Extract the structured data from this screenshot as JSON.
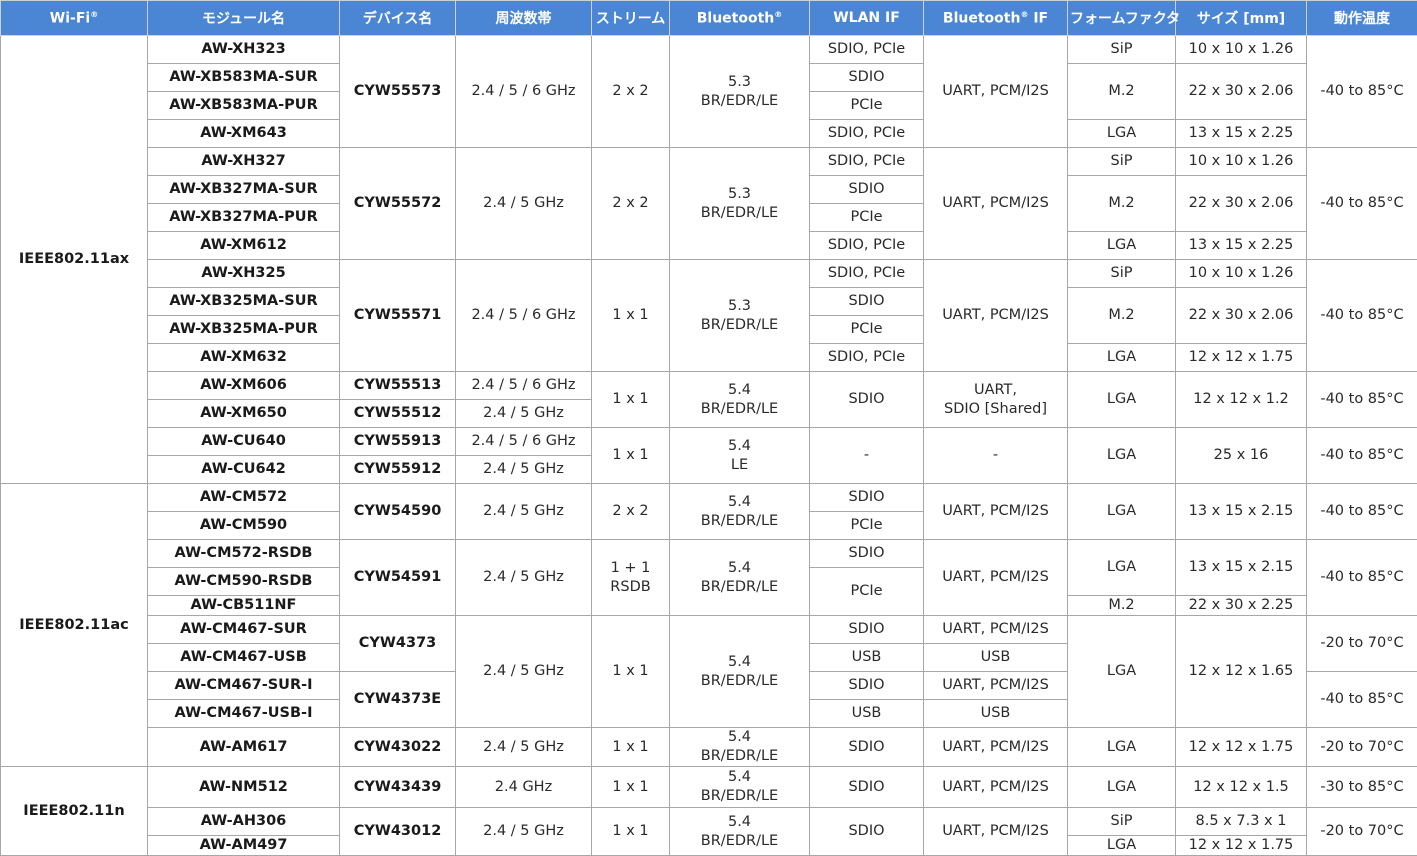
{
  "headers": [
    "Wi-Fi",
    "モジュール名",
    "デバイス名",
    "周波数帯",
    "ストリーム",
    "Bluetooth",
    "WLAN IF",
    "Bluetooth",
    "フォームファクタ",
    "サイズ [mm]",
    "動作温度"
  ],
  "header_registered_mark": "®",
  "header_suffix_if": "IF",
  "rows": [
    [
      "IEEE802.11ax",
      "AW-XH323",
      "CYW55573",
      "2.4 / 5 / 6 GHz",
      "2 x 2",
      "5.3",
      "BR/EDR/LE",
      "SDIO, PCIe",
      "UART, PCM/I2S",
      "SiP",
      "10 x 10 x 1.26",
      "-40 to 85°C"
    ],
    [
      "",
      "AW-XB583MA-SUR",
      "",
      "",
      "",
      "",
      "",
      "SDIO",
      "",
      "M.2",
      "22 x 30 x 2.06",
      ""
    ],
    [
      "",
      "AW-XB583MA-PUR",
      "",
      "",
      "",
      "",
      "",
      "PCIe",
      "",
      "",
      "",
      ""
    ],
    [
      "",
      "AW-XM643",
      "",
      "",
      "",
      "",
      "",
      "SDIO, PCIe",
      "",
      "LGA",
      "13 x 15 x 2.25",
      ""
    ],
    [
      "",
      "AW-XH327",
      "CYW55572",
      "2.4 / 5 GHz",
      "2 x 2",
      "5.3",
      "BR/EDR/LE",
      "SDIO, PCIe",
      "UART, PCM/I2S",
      "SiP",
      "10 x 10 x 1.26",
      "-40 to 85°C"
    ],
    [
      "",
      "AW-XB327MA-SUR",
      "",
      "",
      "",
      "",
      "",
      "SDIO",
      "",
      "M.2",
      "22 x 30 x 2.06",
      ""
    ],
    [
      "",
      "AW-XB327MA-PUR",
      "",
      "",
      "",
      "",
      "",
      "PCIe",
      "",
      "",
      "",
      ""
    ],
    [
      "",
      "AW-XM612",
      "",
      "",
      "",
      "",
      "",
      "SDIO, PCIe",
      "",
      "LGA",
      "13 x 15 x 2.25",
      ""
    ],
    [
      "",
      "AW-XH325",
      "CYW55571",
      "2.4 / 5 / 6 GHz",
      "1 x 1",
      "5.3",
      "BR/EDR/LE",
      "SDIO, PCIe",
      "UART, PCM/I2S",
      "SiP",
      "10 x 10 x 1.26",
      "-40 to 85°C"
    ],
    [
      "",
      "AW-XB325MA-SUR",
      "",
      "",
      "",
      "",
      "",
      "SDIO",
      "",
      "M.2",
      "22 x 30 x 2.06",
      ""
    ],
    [
      "",
      "AW-XB325MA-PUR",
      "",
      "",
      "",
      "",
      "",
      "PCIe",
      "",
      "",
      "",
      ""
    ],
    [
      "",
      "AW-XM632",
      "",
      "",
      "",
      "",
      "",
      "SDIO, PCIe",
      "",
      "LGA",
      "12 x 12 x 1.75",
      ""
    ],
    [
      "",
      "AW-XM606",
      "CYW55513",
      "2.4 / 5 / 6 GHz",
      "1 x 1",
      "5.4",
      "BR/EDR/LE",
      "SDIO",
      "UART,",
      "LGA",
      "12 x 12 x 1.2",
      "-40 to 85°C"
    ],
    [
      "",
      "AW-XM650",
      "CYW55512",
      "2.4 / 5 GHz",
      "",
      "",
      "",
      "",
      "SDIO [Shared]",
      "",
      "",
      ""
    ],
    [
      "",
      "AW-CU640",
      "CYW55913",
      "2.4 / 5 / 6 GHz",
      "1 x 1",
      "5.4",
      "LE",
      "-",
      "-",
      "LGA",
      "25 x 16",
      "-40 to 85°C"
    ],
    [
      "",
      "AW-CU642",
      "CYW55912",
      "2.4 / 5 GHz",
      "",
      "",
      "",
      "",
      "",
      "",
      "",
      ""
    ],
    [
      "IEEE802.11ac",
      "AW-CM572",
      "CYW54590",
      "2.4 / 5 GHz",
      "2 x 2",
      "5.4",
      "BR/EDR/LE",
      "SDIO",
      "UART, PCM/I2S",
      "LGA",
      "13 x 15 x 2.15",
      "-40 to 85°C"
    ],
    [
      "",
      "AW-CM590",
      "",
      "",
      "",
      "",
      "",
      "PCIe",
      "",
      "",
      "",
      ""
    ],
    [
      "",
      "AW-CM572-RSDB",
      "CYW54591",
      "2.4 / 5 GHz",
      "1 + 1",
      "5.4",
      "BR/EDR/LE",
      "SDIO",
      "UART, PCM/I2S",
      "LGA",
      "13 x 15 x 2.15",
      "-40 to 85°C"
    ],
    [
      "",
      "AW-CM590-RSDB",
      "",
      "",
      "RSDB",
      "",
      "",
      "PCIe",
      "",
      "",
      "",
      ""
    ],
    [
      "",
      "AW-CB511NF",
      "",
      "",
      "",
      "",
      "",
      "",
      "",
      "M.2",
      "22 x 30 x 2.25",
      ""
    ],
    [
      "",
      "AW-CM467-SUR",
      "CYW4373",
      "2.4 / 5 GHz",
      "1 x 1",
      "5.4",
      "BR/EDR/LE",
      "SDIO",
      "UART, PCM/I2S",
      "LGA",
      "12 x 12 x 1.65",
      "-20 to 70°C"
    ],
    [
      "",
      "AW-CM467-USB",
      "",
      "",
      "",
      "",
      "",
      "USB",
      "USB",
      "",
      "",
      ""
    ],
    [
      "",
      "AW-CM467-SUR-I",
      "CYW4373E",
      "",
      "",
      "",
      "",
      "SDIO",
      "UART, PCM/I2S",
      "",
      "",
      "-40 to 85°C"
    ],
    [
      "",
      "AW-CM467-USB-I",
      "",
      "",
      "",
      "",
      "",
      "USB",
      "USB",
      "",
      "",
      ""
    ],
    [
      "",
      "AW-AM617",
      "CYW43022",
      "2.4 / 5 GHz",
      "1 x 1",
      "5.4",
      "BR/EDR/LE",
      "SDIO",
      "UART, PCM/I2S",
      "LGA",
      "12 x 12 x 1.75",
      "-20 to 70°C"
    ],
    [
      "IEEE802.11n",
      "AW-NM512",
      "CYW43439",
      "2.4 GHz",
      "1 x 1",
      "5.4",
      "BR/EDR/LE",
      "SDIO",
      "UART, PCM/I2S",
      "LGA",
      "12 x 12 x 1.5",
      "-30 to 85°C"
    ],
    [
      "",
      "AW-AH306",
      "CYW43012",
      "2.4 / 5 GHz",
      "1 x 1",
      "5.4",
      "BR/EDR/LE",
      "SDIO",
      "UART, PCM/I2S",
      "SiP",
      "8.5 x 7.3 x 1",
      "-20 to 70°C"
    ],
    [
      "",
      "AW-AM497",
      "",
      "",
      "",
      "",
      "",
      "",
      "",
      "LGA",
      "12 x 12 x 1.75",
      ""
    ]
  ]
}
